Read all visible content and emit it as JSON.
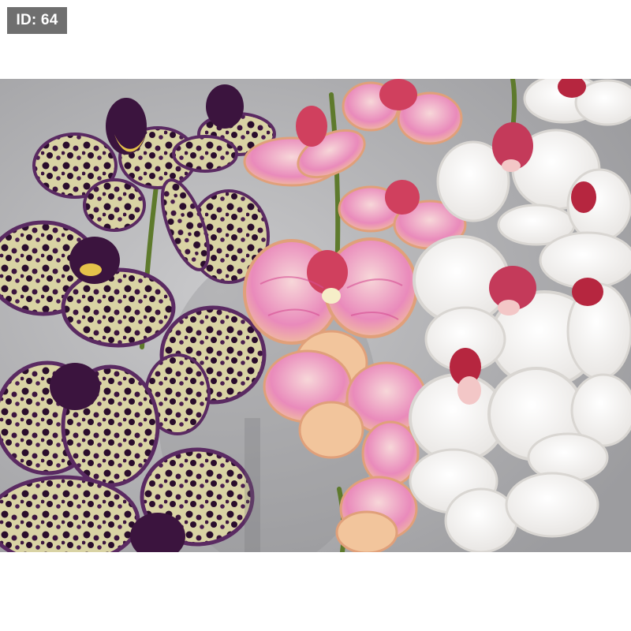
{
  "badge": {
    "label": "ID: 64"
  },
  "photo": {
    "subject": "orchid-photo",
    "colors": {
      "background_wall": "#b8b8ba",
      "purple_orchid": "#4a1f4f",
      "purple_spots": "#2a0d2c",
      "purple_cream": "#d9d3a4",
      "pink_orchid": "#f0b9c6",
      "pink_veins": "#d64f93",
      "pink_peach": "#f2c59c",
      "white_orchid": "#f4f2ef",
      "magenta_lip": "#b6263f",
      "stem_green": "#5e7a2c"
    }
  }
}
